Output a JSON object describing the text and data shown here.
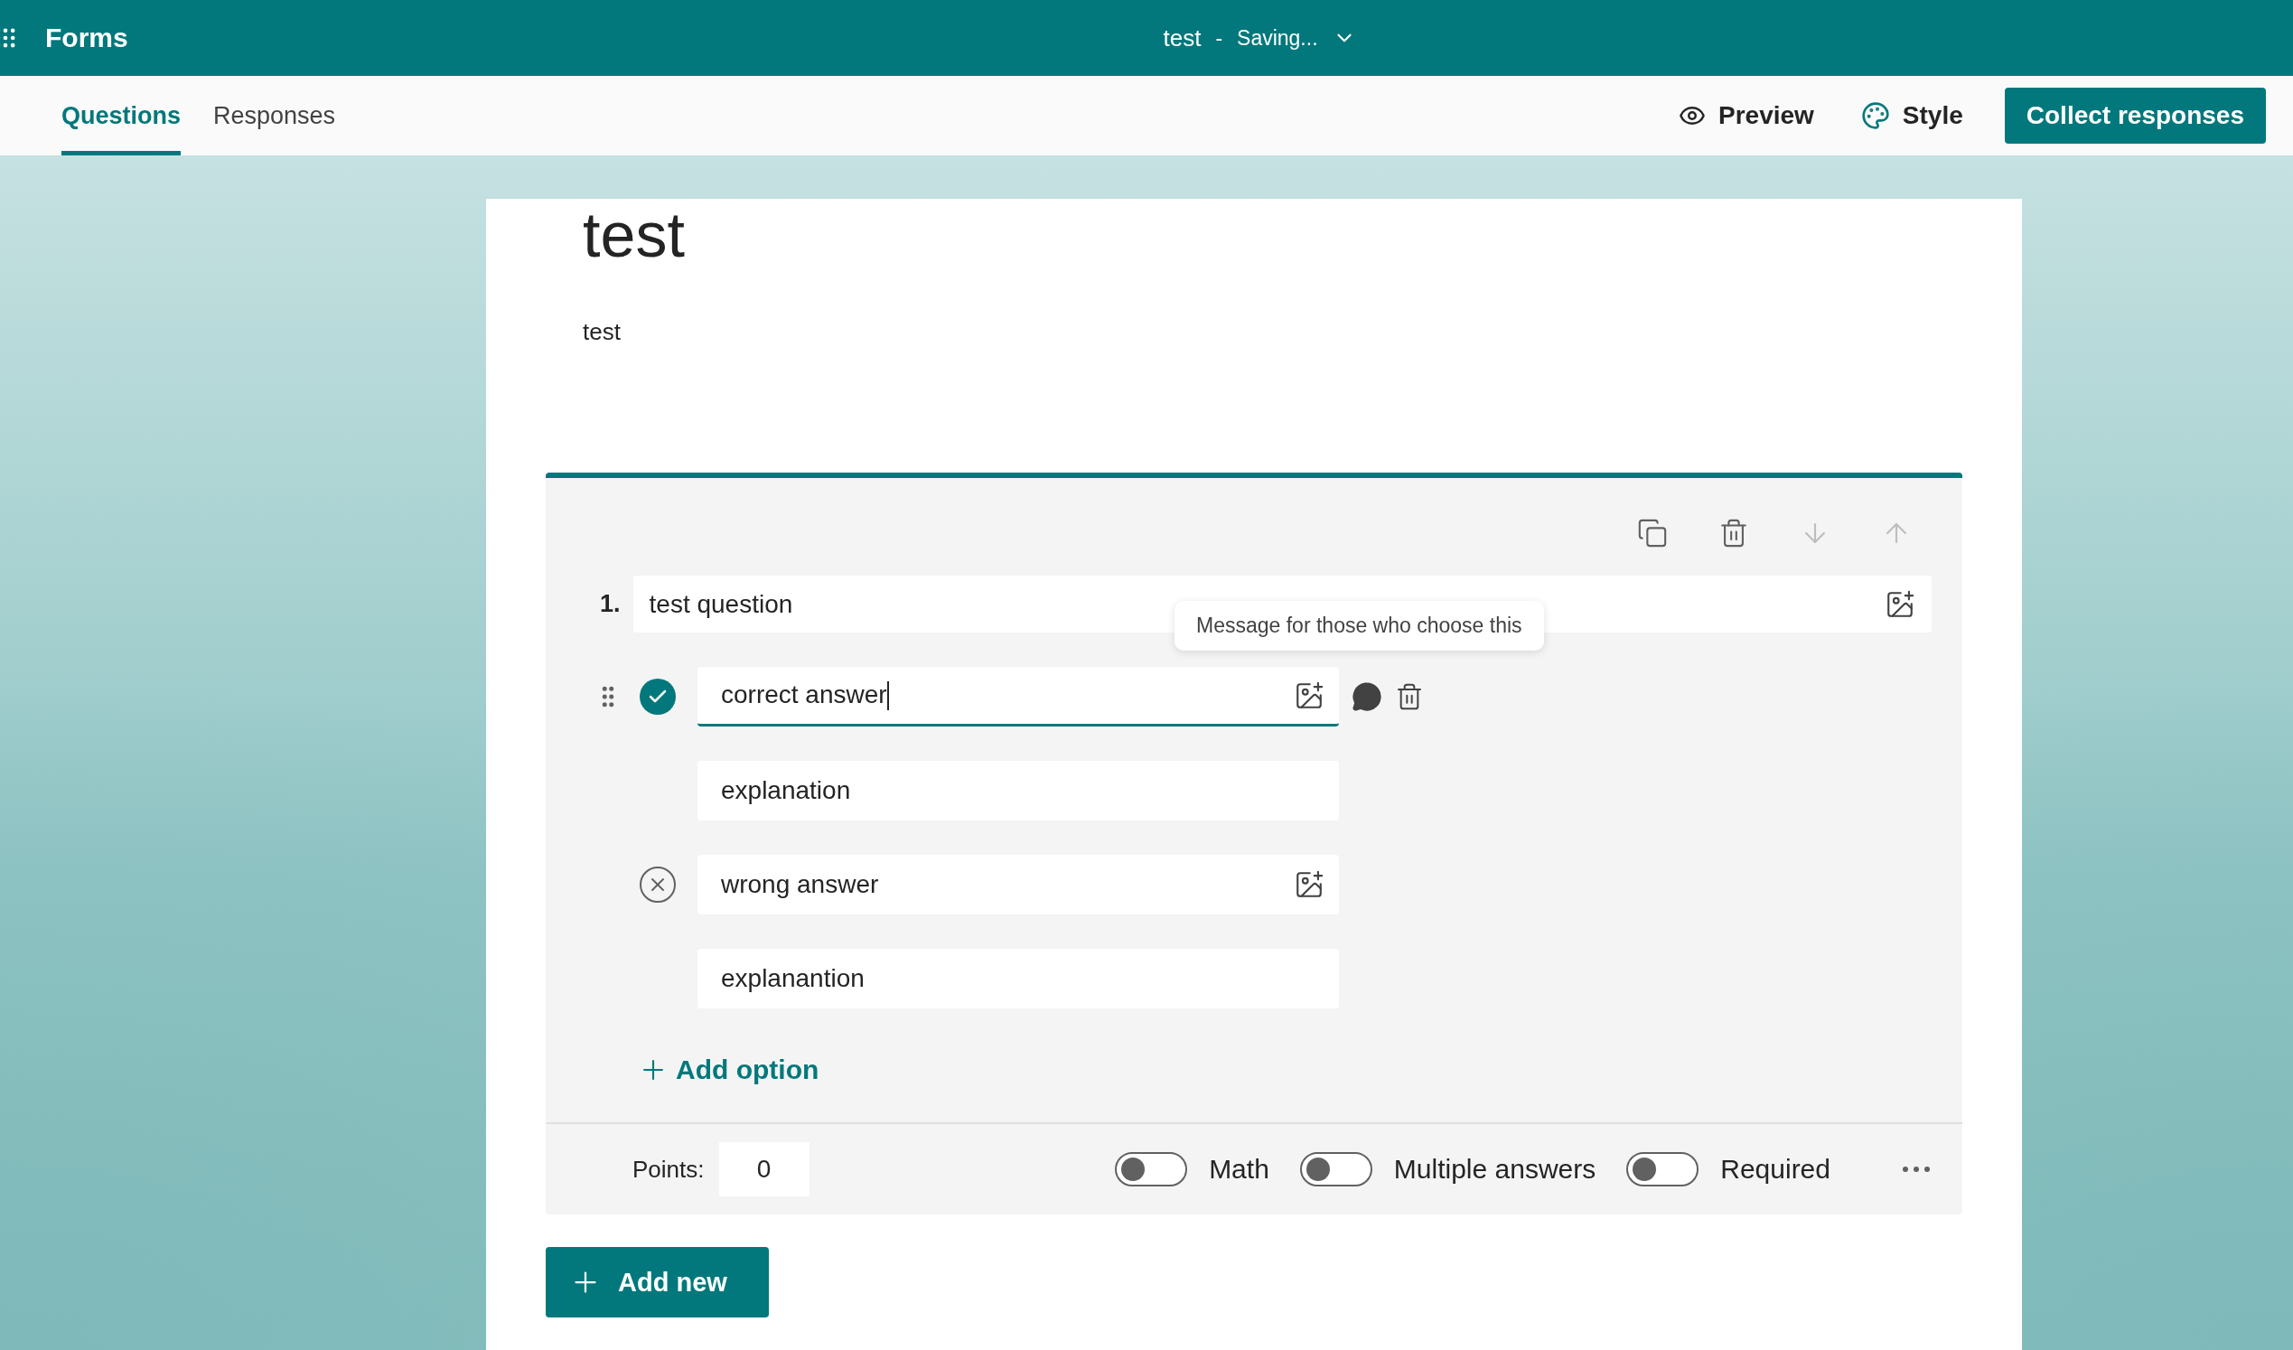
{
  "app": {
    "name": "Forms"
  },
  "document": {
    "title": "test",
    "separator": "-",
    "status": "Saving..."
  },
  "tabs": [
    {
      "label": "Questions",
      "selected": true
    },
    {
      "label": "Responses",
      "selected": false
    }
  ],
  "actions": {
    "preview": "Preview",
    "style": "Style",
    "collect": "Collect responses"
  },
  "form": {
    "title": "test",
    "description": "test"
  },
  "question": {
    "number": "1.",
    "text": "test question",
    "tooltip": "Message for those who choose this",
    "add_option": "Add option",
    "points_label": "Points:",
    "points": "0",
    "options": [
      {
        "text": "correct answer",
        "correct": true,
        "focused": true,
        "explanation": "explanation"
      },
      {
        "text": "wrong answer",
        "correct": false,
        "focused": false,
        "explanation": "explanantion"
      }
    ],
    "toggles": [
      {
        "label": "Math",
        "on": false
      },
      {
        "label": "Multiple answers",
        "on": false
      },
      {
        "label": "Required",
        "on": false
      }
    ]
  },
  "add_new": "Add new"
}
